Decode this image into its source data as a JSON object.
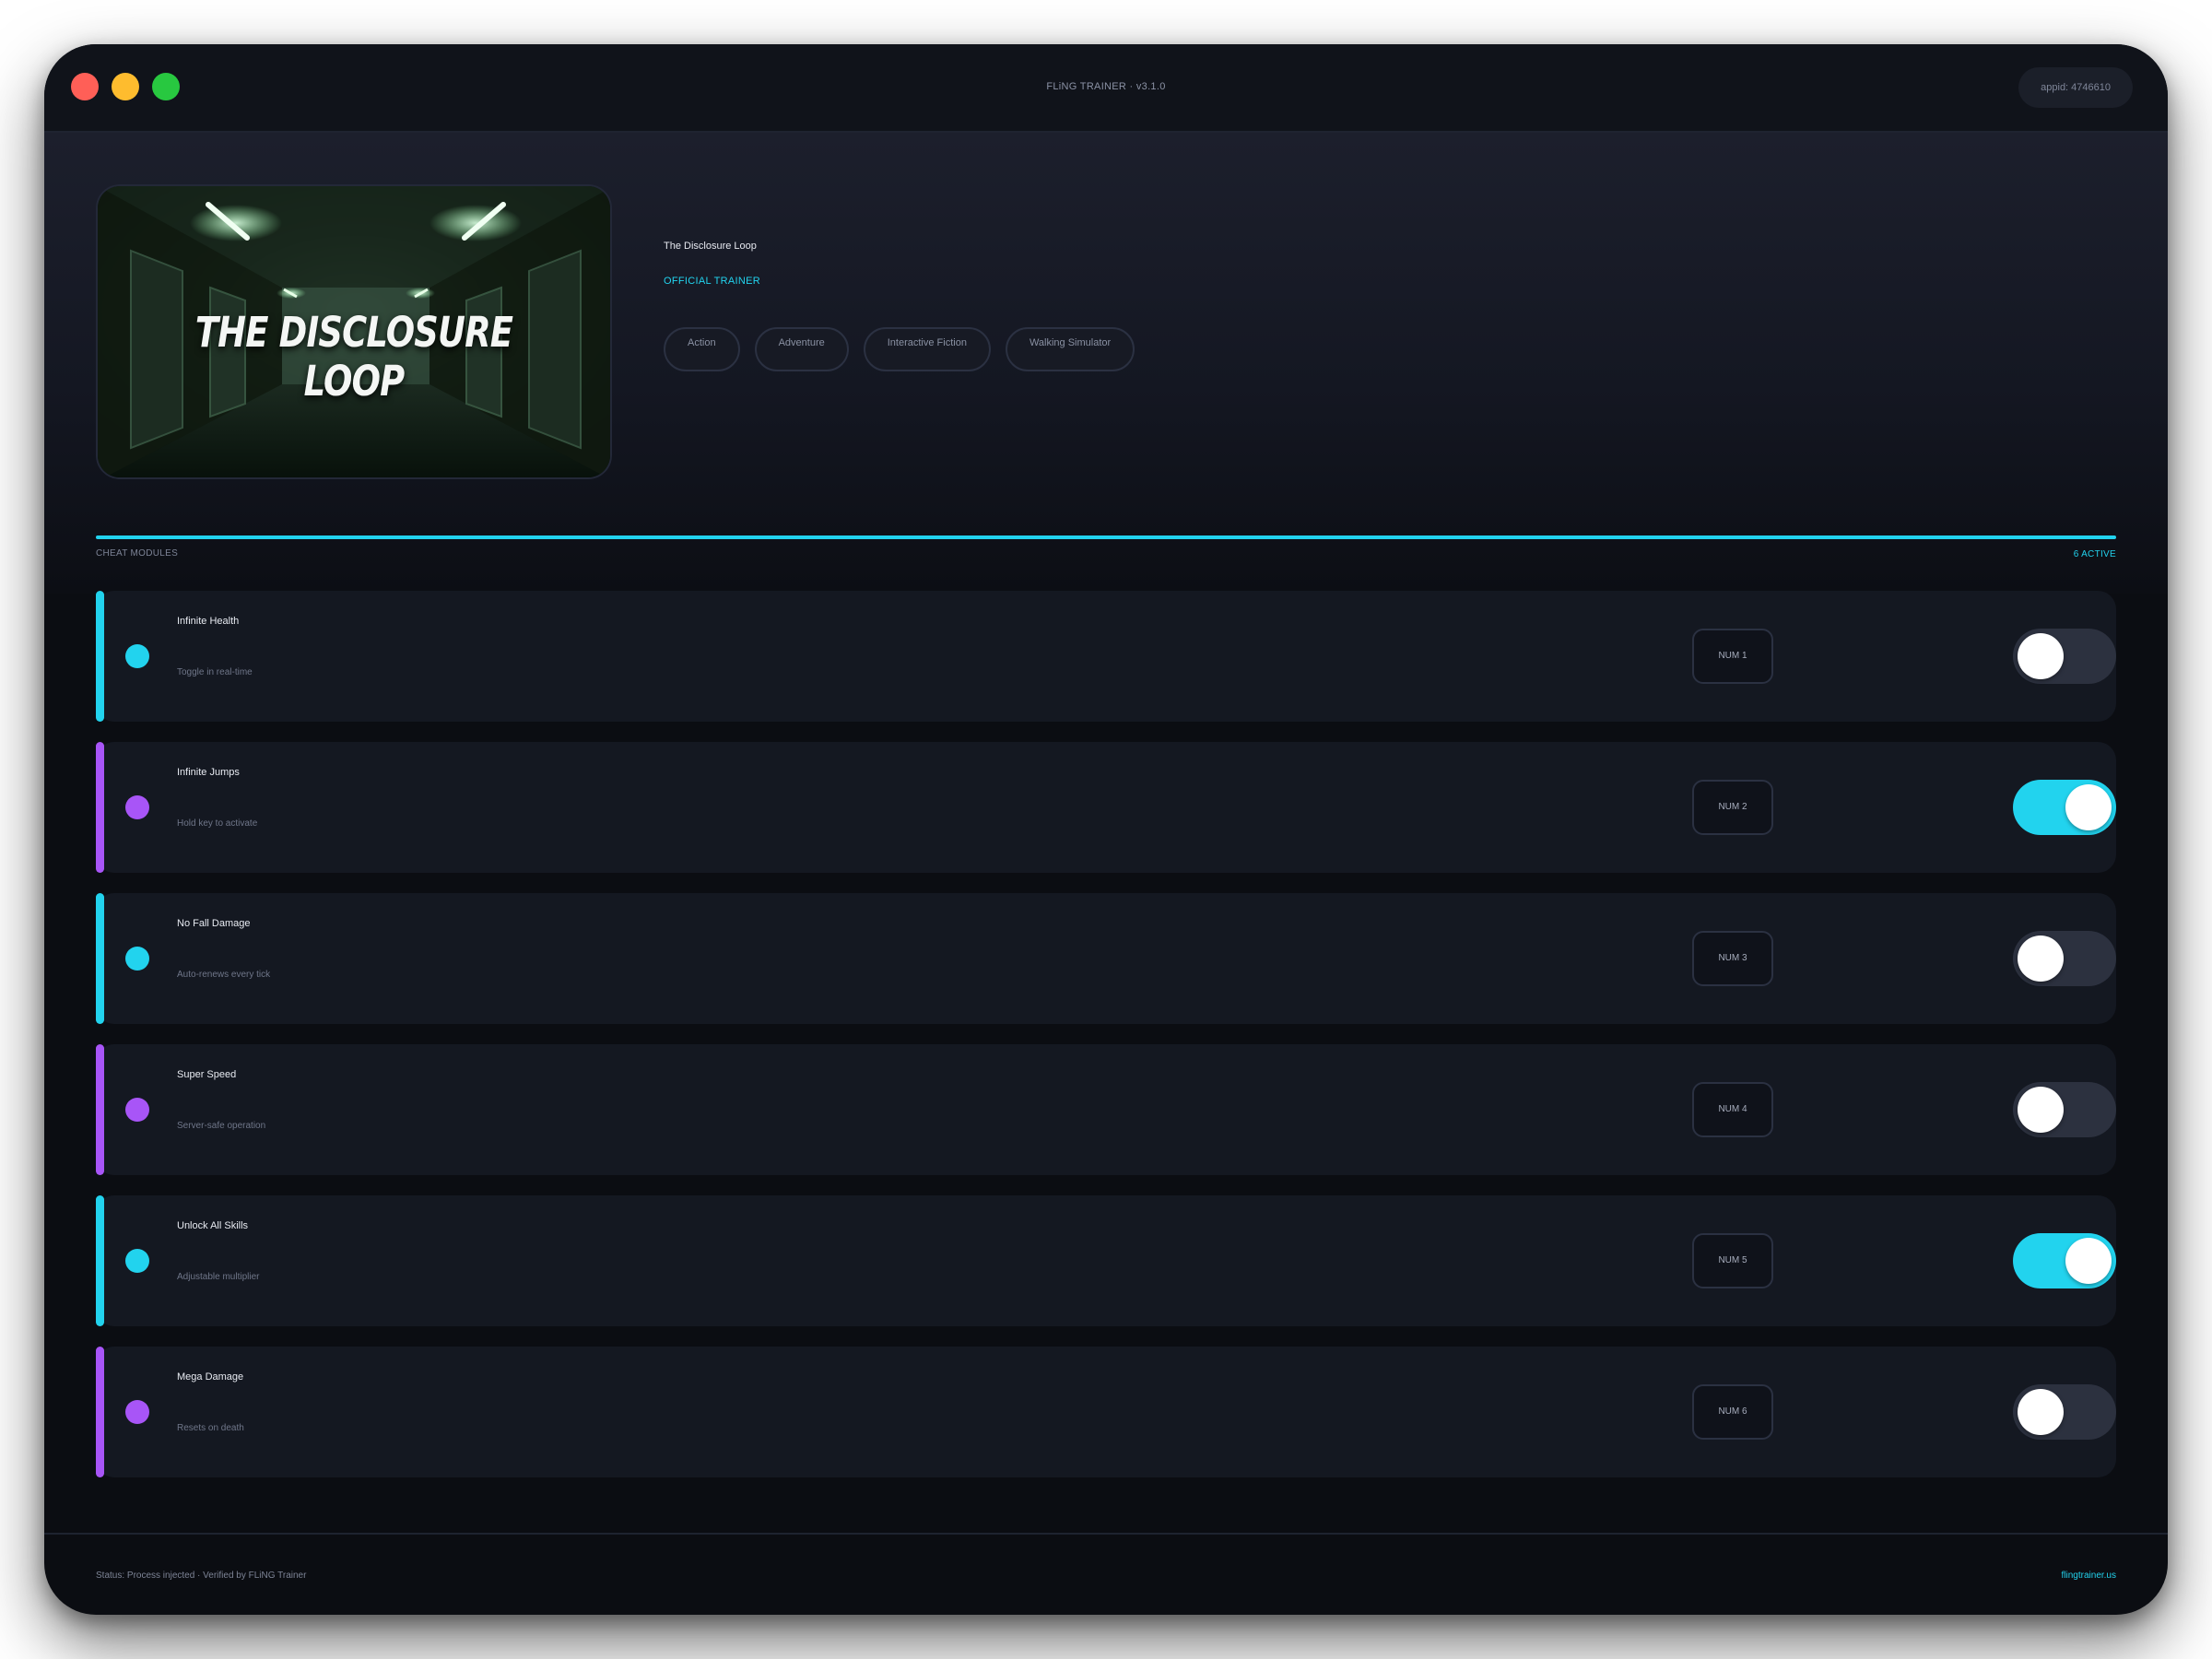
{
  "window": {
    "title": "FLiNG TRAINER · v3.1.0",
    "appid": "appid: 4746610"
  },
  "game": {
    "title": "The Disclosure Loop",
    "cover_text": "THE DISCLOSURE LOOP",
    "badge": "OFFICIAL TRAINER",
    "tags": [
      "Action",
      "Adventure",
      "Interactive Fiction",
      "Walking Simulator"
    ]
  },
  "section": {
    "label": "CHEAT MODULES",
    "count": "6 ACTIVE"
  },
  "colors": {
    "accent_cyan": "#22d3ee",
    "accent_purple": "#a855f7",
    "background": "#0b0d12"
  },
  "cheats": [
    {
      "name": "Infinite Health",
      "desc": "Toggle in real-time",
      "hotkey": "NUM 1",
      "enabled": false,
      "accent": "cyan"
    },
    {
      "name": "Infinite Jumps",
      "desc": "Hold key to activate",
      "hotkey": "NUM 2",
      "enabled": true,
      "accent": "purple"
    },
    {
      "name": "No Fall Damage",
      "desc": "Auto-renews every tick",
      "hotkey": "NUM 3",
      "enabled": false,
      "accent": "cyan"
    },
    {
      "name": "Super Speed",
      "desc": "Server-safe operation",
      "hotkey": "NUM 4",
      "enabled": false,
      "accent": "purple"
    },
    {
      "name": "Unlock All Skills",
      "desc": "Adjustable multiplier",
      "hotkey": "NUM 5",
      "enabled": true,
      "accent": "cyan"
    },
    {
      "name": "Mega Damage",
      "desc": "Resets on death",
      "hotkey": "NUM 6",
      "enabled": false,
      "accent": "purple"
    }
  ],
  "footer": {
    "status": "Status: Process injected · Verified by FLiNG Trainer",
    "link": "flingtrainer.us"
  }
}
